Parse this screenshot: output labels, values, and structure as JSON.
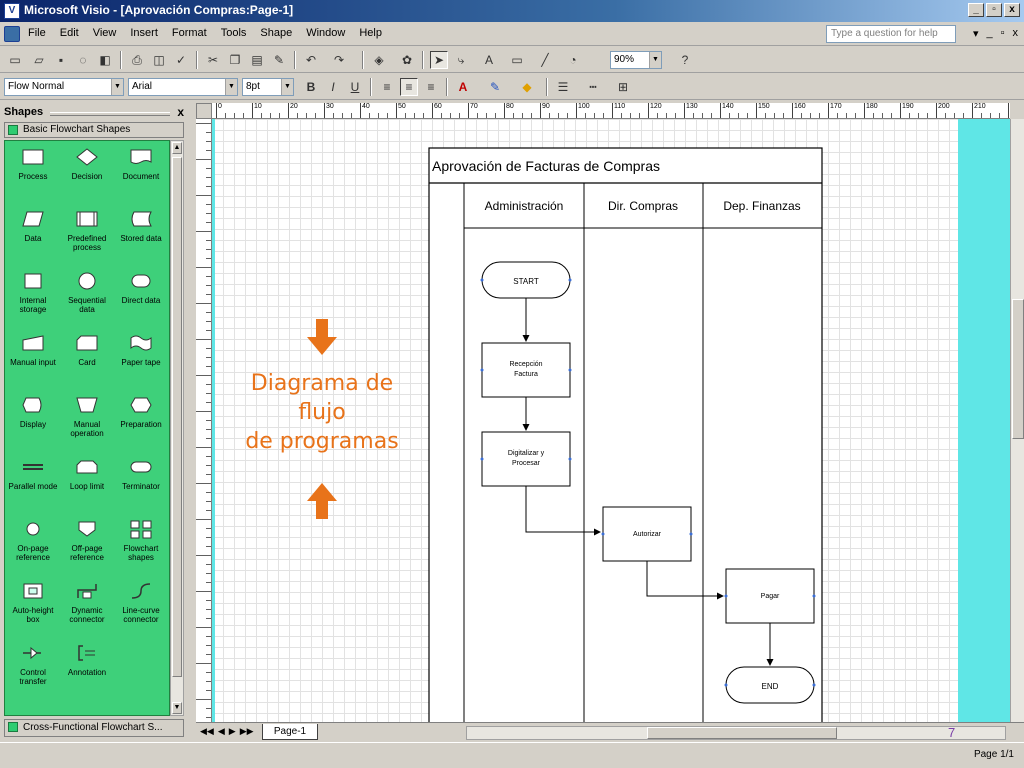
{
  "window": {
    "title": "Microsoft Visio - [Aprovación Compras:Page-1]",
    "controls": [
      "_",
      "▫",
      "x"
    ]
  },
  "menu": {
    "items": [
      "File",
      "Edit",
      "View",
      "Insert",
      "Format",
      "Tools",
      "Shape",
      "Window",
      "Help"
    ],
    "help_placeholder": "Type a question for help",
    "right_controls": [
      "▾",
      "_",
      "▫",
      "x"
    ]
  },
  "toolbar": {
    "zoom": "90%",
    "style": "Flow Normal",
    "font": "Arial",
    "font_size": "8pt",
    "bold": "B",
    "italic": "I",
    "underline": "U",
    "text_tool": "A"
  },
  "shapes_panel": {
    "title": "Shapes",
    "close": "x",
    "stencil": "Basic Flowchart Shapes",
    "footer_stencil": "Cross-Functional Flowchart S...",
    "items": [
      "Process",
      "Decision",
      "Document",
      "Data",
      "Predefined process",
      "Stored data",
      "Internal storage",
      "Sequential data",
      "Direct data",
      "Manual input",
      "Card",
      "Paper tape",
      "Display",
      "Manual operation",
      "Preparation",
      "Parallel mode",
      "Loop limit",
      "Terminator",
      "On-page reference",
      "Off-page reference",
      "Flowchart shapes",
      "Auto-height box",
      "Dynamic connector",
      "Line-curve connector",
      "Control transfer",
      "Annotation"
    ]
  },
  "ruler": {
    "marks": [
      "0",
      "10",
      "20",
      "30",
      "40",
      "50",
      "60",
      "70",
      "80",
      "90",
      "100",
      "110",
      "120",
      "130",
      "140",
      "150",
      "160",
      "170",
      "180",
      "190",
      "200",
      "210",
      "220"
    ]
  },
  "diagram": {
    "title": "Aprovación de Facturas de Compras",
    "lanes": [
      "Administración",
      "Dir. Compras",
      "Dep. Finanzas"
    ],
    "steps": {
      "start": "START",
      "recepcion_l1": "Recepción",
      "recepcion_l2": "Factura",
      "digitalizar_l1": "Digitalizar y",
      "digitalizar_l2": "Procesar",
      "autorizar": "Autorizar",
      "pagar": "Pagar",
      "end": "END"
    }
  },
  "annotation": {
    "line1": "Diagrama de",
    "line2": "flujo",
    "line3": "de programas",
    "color": "#e8731a"
  },
  "bottom": {
    "page_tab": "Page-1",
    "slide_number": "7",
    "page_status": "Page 1/1"
  }
}
